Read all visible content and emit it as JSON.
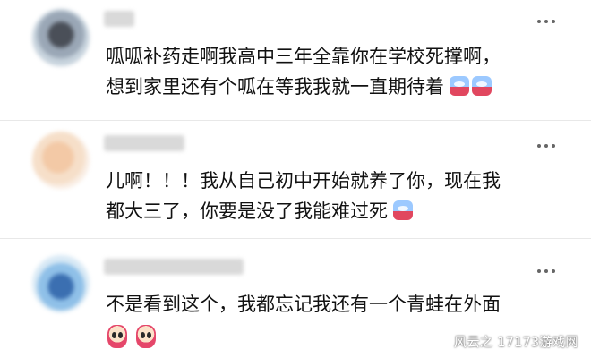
{
  "comments": [
    {
      "lines": [
        "呱呱补药走啊我高中三年全靠你在学校死撑啊，",
        "想到家里还有个呱在等我我就一直期待着"
      ],
      "emojis_inline": [
        "crying-frog-emoji",
        "crying-frog-emoji"
      ]
    },
    {
      "lines": [
        "儿啊！！！我从自己初中开始就养了你，现在我",
        "都大三了，你要是没了我能难过死"
      ],
      "emojis_inline": [
        "crying-frog-emoji"
      ]
    },
    {
      "lines": [
        "不是看到这个，我都忘记我还有一个青蛙在外面"
      ],
      "emojis_below": [
        "scared-face-emoji",
        "scared-face-emoji"
      ]
    }
  ],
  "watermark": "风云之 17173游戏网"
}
